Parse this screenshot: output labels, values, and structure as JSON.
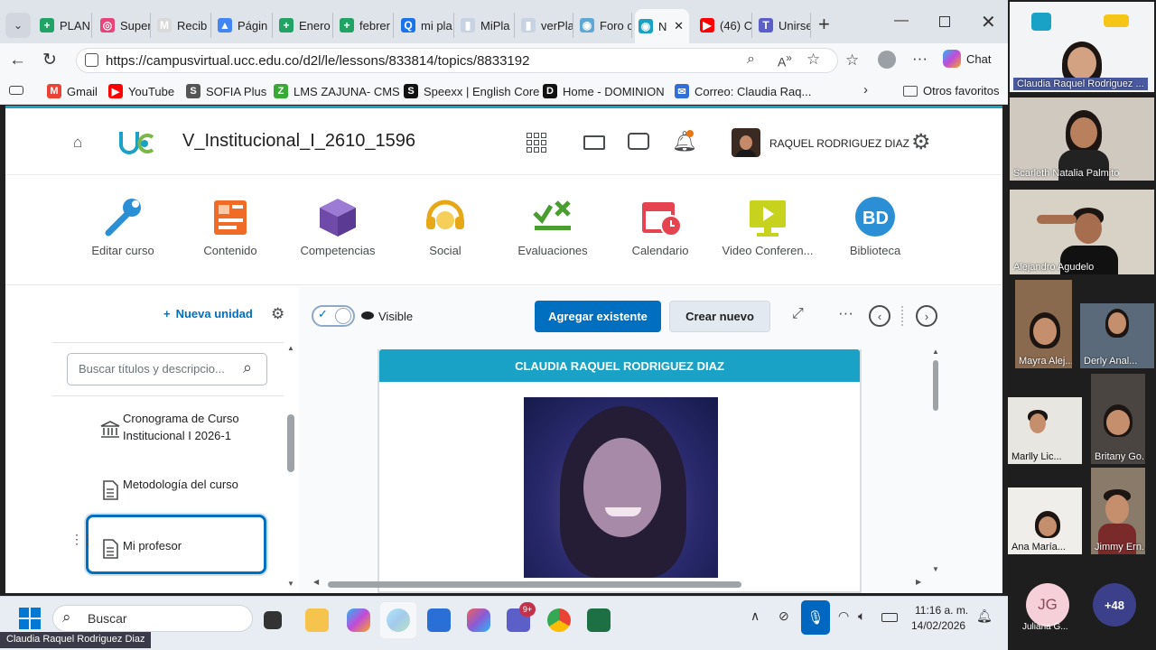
{
  "browser": {
    "tabs": [
      {
        "label": "PLAN",
        "color": "#21a366",
        "glyph": "+"
      },
      {
        "label": "Super",
        "color": "#e8437a",
        "glyph": "◎"
      },
      {
        "label": "Recib",
        "color": "#d9d9d9",
        "glyph": "M"
      },
      {
        "label": "Págin",
        "color": "#4285f4",
        "glyph": "▲"
      },
      {
        "label": "Enero",
        "color": "#21a366",
        "glyph": "+"
      },
      {
        "label": "febrer",
        "color": "#21a366",
        "glyph": "+"
      },
      {
        "label": "mi pla",
        "color": "#1a73e8",
        "glyph": "Q"
      },
      {
        "label": "MiPla",
        "color": "#c7d2e2",
        "glyph": "▮"
      },
      {
        "label": "verPla",
        "color": "#c7d2e2",
        "glyph": "▮"
      },
      {
        "label": "Foro c",
        "color": "#5fa8d3",
        "glyph": "◉"
      },
      {
        "label": "N",
        "color": "#1aa1c6",
        "glyph": "◉"
      },
      {
        "label": "(46) C",
        "color": "#ff0000",
        "glyph": "▶"
      },
      {
        "label": "Unirse",
        "color": "#5b5fc7",
        "glyph": "T"
      }
    ],
    "url": "https://campusvirtual.ucc.edu.co/d2l/le/lessons/833814/topics/8833192",
    "chat_label": "Chat",
    "bookmarks": [
      {
        "label": "Gmail",
        "color": "#ea4335",
        "glyph": "M"
      },
      {
        "label": "YouTube",
        "color": "#ff0000",
        "glyph": "▶"
      },
      {
        "label": "SOFIA Plus",
        "color": "#555",
        "glyph": "S"
      },
      {
        "label": "LMS ZAJUNA- CMS",
        "color": "#39a935",
        "glyph": "Z"
      },
      {
        "label": "Speexx | English Core",
        "color": "#111",
        "glyph": "S"
      },
      {
        "label": "Home - DOMINION",
        "color": "#111",
        "glyph": "D"
      },
      {
        "label": "Correo: Claudia Raq...",
        "color": "#2f6fd6",
        "glyph": "✉"
      }
    ],
    "other_favorites": "Otros favoritos"
  },
  "lms": {
    "course_title": "V_Institucional_I_2610_1596",
    "user_name": "RAQUEL RODRIGUEZ DIAZ",
    "nav": [
      {
        "label": "Editar curso",
        "icon": "wrench-icon",
        "color": "#2b8fd6"
      },
      {
        "label": "Contenido",
        "icon": "content-icon",
        "color": "#f06b25"
      },
      {
        "label": "Competencias",
        "icon": "cube-icon",
        "color": "#6f4aa8"
      },
      {
        "label": "Social",
        "icon": "headset-icon",
        "color": "#e6a817"
      },
      {
        "label": "Evaluaciones",
        "icon": "grading-icon",
        "color": "#4a9d2f"
      },
      {
        "label": "Calendario",
        "icon": "calendar-icon",
        "color": "#e4434f"
      },
      {
        "label": "Video Conferen...",
        "icon": "video-icon",
        "color": "#c7d21f"
      },
      {
        "label": "Biblioteca",
        "icon": "library-icon",
        "color": "#2b8fd6"
      }
    ],
    "new_unit": "Nueva unidad",
    "search_placeholder": "Buscar títulos y descripcio...",
    "toc": [
      {
        "label_1": "Cronograma de Curso",
        "label_2": "Institucional I 2026-1",
        "icon": "bank-icon"
      },
      {
        "label_1": "Metodología del curso",
        "icon": "document-icon"
      },
      {
        "label_1": "Mi profesor",
        "icon": "document-icon",
        "selected": true
      }
    ],
    "visible_label": "Visible",
    "add_existing": "Agregar existente",
    "create_new": "Crear nuevo",
    "card_title": "CLAUDIA RAQUEL RODRIGUEZ DIAZ"
  },
  "taskbar": {
    "search": "Buscar",
    "time": "11:16 a. m.",
    "date": "14/02/2026",
    "teams_badge": "9+"
  },
  "meeting": {
    "presenter_label": "Claudia Raquel Rodriguez Diaz",
    "participants": [
      "Claudia Raquel Rodriguez ...",
      "Scarleth Natalia Palmito",
      "Alejandro Agudelo",
      "Mayra Alej...",
      "Derly Anal...",
      "Marlly Lic...",
      "Britany Go...",
      "Ana María...",
      "Jimmy Ern...",
      "Juliana G..."
    ],
    "initials": "JG",
    "more_count": "+48"
  }
}
